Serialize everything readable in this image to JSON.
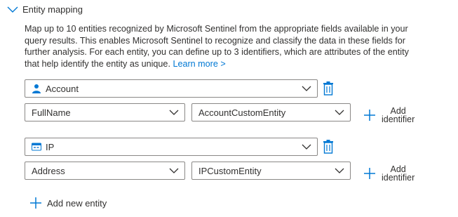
{
  "section": {
    "title": "Entity mapping",
    "description": "Map up to 10 entities recognized by Microsoft Sentinel from the appropriate fields available in your query results. This enables Microsoft Sentinel to recognize and classify the data in these fields for further analysis. For each entity, you can define up to 3 identifiers, which are attributes of the entity that help identify the entity as unique.",
    "learn_more": "Learn more >"
  },
  "entities": [
    {
      "type": "Account",
      "icon": "user-icon",
      "identifier": "FullName",
      "column": "AccountCustomEntity",
      "add_identifier_line1": "Add",
      "add_identifier_line2": "identifier"
    },
    {
      "type": "IP",
      "icon": "ip-address-icon",
      "identifier": "Address",
      "column": "IPCustomEntity",
      "add_identifier_line1": "Add",
      "add_identifier_line2": "identifier"
    }
  ],
  "add_entity_label": "Add new entity",
  "colors": {
    "accent": "#0078d4",
    "border": "#8a8886",
    "text": "#323130"
  }
}
